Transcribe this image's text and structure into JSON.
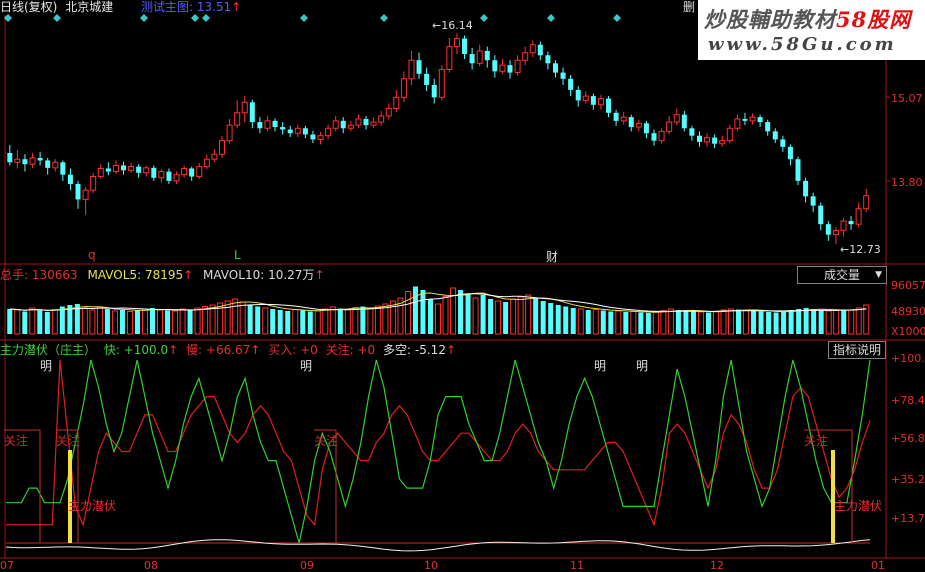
{
  "header": {
    "period": "日线(复权)",
    "stock": "北京城建",
    "trial_label": "测试主图",
    "trial_value": "13.51",
    "arrow": "↑",
    "corner": "删"
  },
  "watermark": {
    "title_a": "炒股輔助教材",
    "title_b": "58股网",
    "url": "www.58Gu.com"
  },
  "price_panel": {
    "high_label": "16.14",
    "low_label": "12.73",
    "axis": [
      "15.07",
      "13.80"
    ],
    "markers": [
      "q",
      "L",
      "财"
    ],
    "candles": [
      [
        14.2,
        14.05,
        14.33,
        14.0
      ],
      [
        14.05,
        14.1,
        14.25,
        13.95
      ],
      [
        14.1,
        14.02,
        14.18,
        13.9
      ],
      [
        14.02,
        14.12,
        14.2,
        13.96
      ],
      [
        14.12,
        14.08,
        14.22,
        14.0
      ],
      [
        14.08,
        13.96,
        14.12,
        13.85
      ],
      [
        13.96,
        14.05,
        14.1,
        13.9
      ],
      [
        14.05,
        13.85,
        14.08,
        13.75
      ],
      [
        13.85,
        13.7,
        13.95,
        13.6
      ],
      [
        13.7,
        13.45,
        13.75,
        13.3
      ],
      [
        13.45,
        13.6,
        13.65,
        13.2
      ],
      [
        13.6,
        13.82,
        13.88,
        13.55
      ],
      [
        13.82,
        13.95,
        14.02,
        13.78
      ],
      [
        13.95,
        13.9,
        14.05,
        13.84
      ],
      [
        13.9,
        14.0,
        14.08,
        13.86
      ],
      [
        14.0,
        13.92,
        14.06,
        13.85
      ],
      [
        13.92,
        13.98,
        14.04,
        13.88
      ],
      [
        13.98,
        13.88,
        14.02,
        13.8
      ],
      [
        13.88,
        13.96,
        14.0,
        13.82
      ],
      [
        13.96,
        13.8,
        14.0,
        13.75
      ],
      [
        13.8,
        13.9,
        13.94,
        13.72
      ],
      [
        13.9,
        13.75,
        13.95,
        13.7
      ],
      [
        13.75,
        13.85,
        13.9,
        13.7
      ],
      [
        13.85,
        13.95,
        14.0,
        13.8
      ],
      [
        13.95,
        13.82,
        13.98,
        13.75
      ],
      [
        13.82,
        13.98,
        14.04,
        13.78
      ],
      [
        13.98,
        14.1,
        14.18,
        13.94
      ],
      [
        14.1,
        14.18,
        14.26,
        14.05
      ],
      [
        14.18,
        14.4,
        14.48,
        14.12
      ],
      [
        14.4,
        14.65,
        14.75,
        14.35
      ],
      [
        14.65,
        14.85,
        15.05,
        14.6
      ],
      [
        14.85,
        15.02,
        15.12,
        14.7
      ],
      [
        15.02,
        14.7,
        15.06,
        14.6
      ],
      [
        14.7,
        14.6,
        14.78,
        14.52
      ],
      [
        14.6,
        14.72,
        14.8,
        14.55
      ],
      [
        14.72,
        14.62,
        14.76,
        14.55
      ],
      [
        14.62,
        14.58,
        14.7,
        14.5
      ],
      [
        14.58,
        14.52,
        14.64,
        14.46
      ],
      [
        14.52,
        14.6,
        14.66,
        14.46
      ],
      [
        14.6,
        14.5,
        14.64,
        14.44
      ],
      [
        14.5,
        14.42,
        14.56,
        14.36
      ],
      [
        14.42,
        14.48,
        14.54,
        14.34
      ],
      [
        14.48,
        14.6,
        14.66,
        14.42
      ],
      [
        14.6,
        14.72,
        14.8,
        14.55
      ],
      [
        14.72,
        14.6,
        14.78,
        14.52
      ],
      [
        14.6,
        14.65,
        14.72,
        14.55
      ],
      [
        14.65,
        14.75,
        14.82,
        14.6
      ],
      [
        14.75,
        14.65,
        14.8,
        14.58
      ],
      [
        14.65,
        14.7,
        14.78,
        14.6
      ],
      [
        14.7,
        14.8,
        14.88,
        14.64
      ],
      [
        14.8,
        14.92,
        15.0,
        14.74
      ],
      [
        14.92,
        15.1,
        15.22,
        14.86
      ],
      [
        15.1,
        15.4,
        15.52,
        15.02
      ],
      [
        15.4,
        15.7,
        15.85,
        15.3
      ],
      [
        15.7,
        15.48,
        15.82,
        15.4
      ],
      [
        15.48,
        15.3,
        15.58,
        15.2
      ],
      [
        15.3,
        15.1,
        15.4,
        15.0
      ],
      [
        15.1,
        15.55,
        15.62,
        15.05
      ],
      [
        15.55,
        15.92,
        16.06,
        15.5
      ],
      [
        15.92,
        16.05,
        16.14,
        15.8
      ],
      [
        16.05,
        15.8,
        16.1,
        15.72
      ],
      [
        15.8,
        15.65,
        15.9,
        15.55
      ],
      [
        15.65,
        15.85,
        15.95,
        15.6
      ],
      [
        15.85,
        15.7,
        15.92,
        15.58
      ],
      [
        15.7,
        15.52,
        15.78,
        15.42
      ],
      [
        15.52,
        15.62,
        15.72,
        15.48
      ],
      [
        15.62,
        15.5,
        15.7,
        15.4
      ],
      [
        15.5,
        15.7,
        15.78,
        15.45
      ],
      [
        15.7,
        15.82,
        15.92,
        15.62
      ],
      [
        15.82,
        15.95,
        16.02,
        15.75
      ],
      [
        15.95,
        15.78,
        16.0,
        15.7
      ],
      [
        15.78,
        15.65,
        15.84,
        15.55
      ],
      [
        15.65,
        15.5,
        15.7,
        15.42
      ],
      [
        15.5,
        15.4,
        15.58,
        15.3
      ],
      [
        15.4,
        15.22,
        15.46,
        15.12
      ],
      [
        15.22,
        15.05,
        15.28,
        14.95
      ],
      [
        15.05,
        15.12,
        15.2,
        15.0
      ],
      [
        15.12,
        14.98,
        15.16,
        14.9
      ],
      [
        14.98,
        15.08,
        15.14,
        14.9
      ],
      [
        15.08,
        14.85,
        15.12,
        14.78
      ],
      [
        14.85,
        14.72,
        14.9,
        14.64
      ],
      [
        14.72,
        14.78,
        14.86,
        14.66
      ],
      [
        14.78,
        14.62,
        14.82,
        14.55
      ],
      [
        14.62,
        14.68,
        14.74,
        14.55
      ],
      [
        14.68,
        14.52,
        14.72,
        14.44
      ],
      [
        14.52,
        14.4,
        14.58,
        14.32
      ],
      [
        14.4,
        14.55,
        14.6,
        14.35
      ],
      [
        14.55,
        14.7,
        14.8,
        14.5
      ],
      [
        14.7,
        14.82,
        14.92,
        14.65
      ],
      [
        14.82,
        14.6,
        14.88,
        14.55
      ],
      [
        14.6,
        14.48,
        14.64,
        14.4
      ],
      [
        14.48,
        14.38,
        14.55,
        14.3
      ],
      [
        14.38,
        14.45,
        14.52,
        14.3
      ],
      [
        14.45,
        14.35,
        14.5,
        14.28
      ],
      [
        14.35,
        14.4,
        14.48,
        14.3
      ],
      [
        14.4,
        14.6,
        14.66,
        14.36
      ],
      [
        14.6,
        14.75,
        14.82,
        14.55
      ],
      [
        14.75,
        14.72,
        14.85,
        14.65
      ],
      [
        14.72,
        14.78,
        14.84,
        14.66
      ],
      [
        14.78,
        14.7,
        14.82,
        14.62
      ],
      [
        14.7,
        14.55,
        14.74,
        14.48
      ],
      [
        14.55,
        14.42,
        14.6,
        14.36
      ],
      [
        14.42,
        14.3,
        14.48,
        14.22
      ],
      [
        14.3,
        14.1,
        14.34,
        14.0
      ],
      [
        14.1,
        13.75,
        14.14,
        13.68
      ],
      [
        13.75,
        13.5,
        13.8,
        13.4
      ],
      [
        13.5,
        13.35,
        13.56,
        13.25
      ],
      [
        13.35,
        13.05,
        13.4,
        12.95
      ],
      [
        13.05,
        12.88,
        13.1,
        12.78
      ],
      [
        12.88,
        12.95,
        13.0,
        12.73
      ],
      [
        12.95,
        13.1,
        13.15,
        12.85
      ],
      [
        13.1,
        13.05,
        13.18,
        12.96
      ],
      [
        13.05,
        13.3,
        13.4,
        13.0
      ],
      [
        13.3,
        13.51,
        13.62,
        13.25
      ]
    ]
  },
  "volume_panel": {
    "zongshou_label": "总手",
    "zongshou_value": "130663",
    "mavol5_label": "MAVOL5",
    "mavol5_value": "78195",
    "mavol10_label": "MAVOL10",
    "mavol10_value": "10.27万",
    "dropdown_label": "成交量",
    "axis": [
      "96057",
      "48930",
      "X1000"
    ],
    "volumes": [
      50,
      48,
      45,
      52,
      47,
      44,
      49,
      55,
      58,
      60,
      52,
      48,
      54,
      50,
      46,
      48,
      45,
      47,
      50,
      52,
      49,
      47,
      46,
      50,
      48,
      52,
      55,
      58,
      62,
      66,
      70,
      64,
      58,
      55,
      52,
      50,
      48,
      46,
      49,
      47,
      45,
      46,
      50,
      54,
      51,
      49,
      53,
      55,
      52,
      56,
      60,
      66,
      72,
      85,
      95,
      88,
      70,
      60,
      75,
      92,
      88,
      80,
      72,
      78,
      70,
      66,
      64,
      70,
      74,
      78,
      72,
      66,
      62,
      58,
      55,
      52,
      50,
      48,
      49,
      47,
      45,
      46,
      44,
      45,
      43,
      42,
      44,
      47,
      50,
      48,
      46,
      45,
      44,
      43,
      45,
      48,
      50,
      49,
      48,
      46,
      45,
      44,
      43,
      45,
      48,
      50,
      52,
      50,
      48,
      46,
      47,
      49,
      48,
      52,
      58
    ]
  },
  "indicator_panel": {
    "title": "主力潜伏（庄主）",
    "fast_label": "快",
    "fast_value": "+100.0",
    "slow_label": "慢",
    "slow_value": "+66.67",
    "buy_label": "买入",
    "buy_value": "+0",
    "focus_label": "关注",
    "focus_value": "+0",
    "dk_label": "多空",
    "dk_value": "-5.12",
    "help_button": "指标说明",
    "axis": [
      "+100.0",
      "+78.4",
      "+56.8",
      "+35.2",
      "+13.7"
    ],
    "tags": [
      "明",
      "明",
      "明",
      "明"
    ],
    "attention_tags": [
      "关注",
      "关注",
      "关注",
      "关注"
    ],
    "latent_tags": [
      "主力潜伏",
      "主力潜伏"
    ],
    "fast_series": [
      22,
      22,
      22,
      30,
      30,
      22,
      22,
      22,
      35,
      55,
      75,
      100,
      85,
      65,
      50,
      60,
      80,
      100,
      80,
      60,
      45,
      30,
      45,
      65,
      80,
      90,
      75,
      60,
      45,
      60,
      80,
      90,
      70,
      55,
      45,
      45,
      30,
      15,
      0,
      20,
      45,
      60,
      50,
      35,
      20,
      35,
      55,
      80,
      100,
      85,
      60,
      35,
      30,
      30,
      30,
      45,
      70,
      80,
      80,
      80,
      65,
      55,
      45,
      45,
      60,
      80,
      100,
      85,
      70,
      55,
      45,
      30,
      45,
      65,
      80,
      90,
      80,
      65,
      50,
      35,
      20,
      20,
      20,
      20,
      20,
      45,
      70,
      95,
      80,
      60,
      40,
      20,
      45,
      80,
      100,
      75,
      50,
      35,
      20,
      30,
      55,
      80,
      100,
      85,
      65,
      45,
      30,
      22,
      22,
      22,
      45,
      70,
      100
    ],
    "slow_series": [
      10,
      10,
      10,
      10,
      10,
      10,
      10,
      100,
      60,
      20,
      10,
      30,
      50,
      60,
      55,
      50,
      50,
      60,
      70,
      70,
      60,
      50,
      50,
      60,
      70,
      75,
      80,
      80,
      70,
      60,
      55,
      60,
      70,
      75,
      70,
      60,
      50,
      45,
      30,
      15,
      10,
      40,
      55,
      60,
      55,
      50,
      45,
      45,
      55,
      60,
      70,
      75,
      70,
      60,
      50,
      45,
      45,
      50,
      55,
      60,
      60,
      55,
      50,
      45,
      45,
      50,
      60,
      65,
      60,
      50,
      45,
      40,
      40,
      40,
      40,
      40,
      45,
      50,
      55,
      55,
      50,
      40,
      30,
      20,
      10,
      30,
      60,
      65,
      60,
      50,
      40,
      30,
      40,
      60,
      70,
      65,
      55,
      40,
      30,
      30,
      40,
      60,
      80,
      85,
      80,
      65,
      50,
      35,
      25,
      30,
      40,
      55,
      67
    ]
  },
  "time_axis": [
    "07",
    "08",
    "09",
    "10",
    "11",
    "12",
    "01"
  ]
}
